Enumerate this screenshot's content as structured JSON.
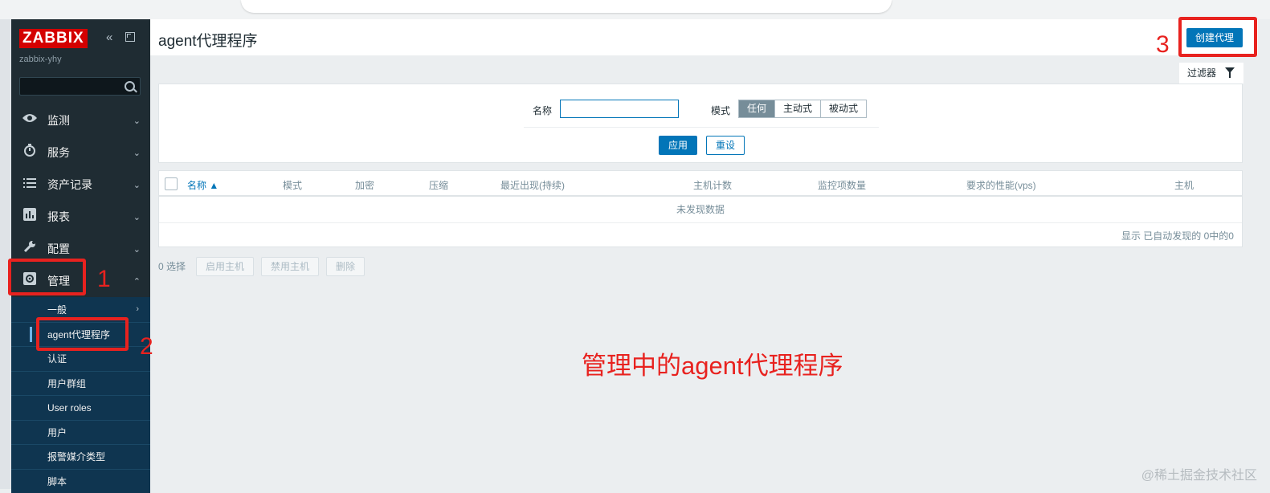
{
  "app": {
    "logo": "ZABBIX",
    "server_name": "zabbix-yhy",
    "collapse_icon": "«"
  },
  "sidebar": {
    "items": [
      {
        "label": "监测",
        "icon": "eye-icon"
      },
      {
        "label": "服务",
        "icon": "clock-icon"
      },
      {
        "label": "资产记录",
        "icon": "list-icon"
      },
      {
        "label": "报表",
        "icon": "bar-chart-icon"
      },
      {
        "label": "配置",
        "icon": "wrench-icon"
      },
      {
        "label": "管理",
        "icon": "gear-icon"
      }
    ],
    "admin_subitems": [
      {
        "label": "一般"
      },
      {
        "label": "agent代理程序"
      },
      {
        "label": "认证"
      },
      {
        "label": "用户群组"
      },
      {
        "label": "User roles"
      },
      {
        "label": "用户"
      },
      {
        "label": "报警媒介类型"
      },
      {
        "label": "脚本"
      }
    ]
  },
  "header": {
    "title": "agent代理程序",
    "create_button": "创建代理"
  },
  "filter": {
    "tab_label": "过滤器",
    "name_label": "名称",
    "name_value": "",
    "mode_label": "模式",
    "mode_options": [
      "任何",
      "主动式",
      "被动式"
    ],
    "mode_selected": "任何",
    "apply": "应用",
    "reset": "重设"
  },
  "table": {
    "columns": [
      "名称 ▲",
      "模式",
      "加密",
      "压缩",
      "最近出现(持续)",
      "主机计数",
      "监控项数量",
      "要求的性能(vps)",
      "主机"
    ],
    "empty_text": "未发现数据",
    "pager_text": "显示 已自动发现的 0中的0"
  },
  "actions": {
    "selected_count": "0 选择",
    "enable_hosts": "启用主机",
    "disable_hosts": "禁用主机",
    "delete": "删除"
  },
  "annotations": {
    "step1": "1",
    "step2": "2",
    "step3": "3",
    "caption": "管理中的agent代理程序",
    "watermark": "@稀土掘金技术社区"
  },
  "colors": {
    "sidebar_bg": "#1f2c33",
    "submenu_bg": "#0f3550",
    "primary": "#0275b8",
    "annotation_red": "#e8221f",
    "logo_red": "#d40000"
  }
}
